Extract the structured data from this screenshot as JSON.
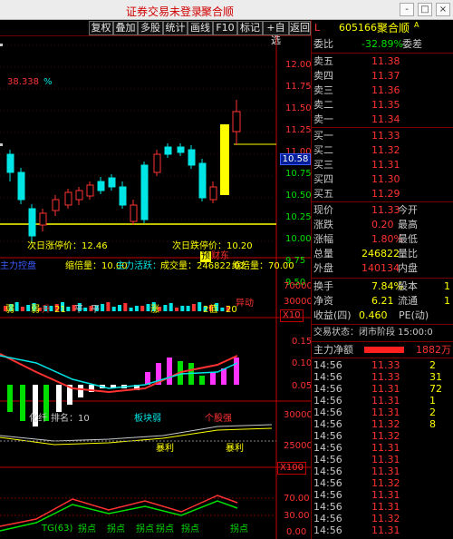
{
  "title_bar": {
    "left_text": "证券交易未登录",
    "right_text": "聚合顺",
    "buttons": [
      "-",
      "□",
      "×"
    ]
  },
  "toolbar": {
    "buttons": [
      "复权",
      "叠加",
      "多股",
      "统计",
      "画线",
      "F10",
      "标记",
      "+自选",
      "返回"
    ],
    "options_glyph": "⚙"
  },
  "main_chart": {
    "price_axis": [
      "12.00",
      "11.75",
      "11.50",
      "11.25",
      "11.00",
      "10.75",
      "10.50",
      "10.25",
      "10.00",
      "9.75",
      "9.50"
    ],
    "current_price_tag": "10.58",
    "indicator_value": "38.338",
    "indicator_unit": "%",
    "next_fall_label": "次日涨停价：12.46",
    "next_limit_label": "次日跌停价：10.20",
    "signal_red": "预",
    "signal_green": "财东",
    "volume_axis": [
      "70000",
      "30000"
    ],
    "volume_bar_labels": {
      "a": "弱",
      "b": "弱",
      "c": "升",
      "d": "21",
      "e": "平",
      "f": "平",
      "g": "涨",
      "h": "2值",
      "i": "20",
      "j": "异动"
    },
    "volume_info": {
      "label1": "主力控盘",
      "label2": "缩倍量：10.00",
      "label3": "主力活跃：",
      "label4": "成交量：246822.02",
      "label5": "缩倍量：70.00"
    },
    "multiplier": "X10",
    "macd_axis": [
      "0.15",
      "0.10",
      "0.05"
    ],
    "sector_info": {
      "name": "化纤",
      "rank_label": "排名：10",
      "strength": "板块弱",
      "sentiment": "个股强"
    },
    "sector_axis": [
      "30000",
      "25000"
    ],
    "bottom_labels": {
      "a": "暴利",
      "b": "暴利"
    },
    "multiplier2": "X100",
    "osc_axis": [
      "70.00",
      "30.00",
      "0.00"
    ],
    "osc_bottom_labels": [
      "TG(63)",
      "拐点",
      "拐点",
      "拐点",
      "拐点",
      "拐点",
      "拐点"
    ]
  },
  "quote_panel": {
    "marker": "L",
    "code": "605166",
    "name": "聚合顺",
    "name_suffix": "A",
    "weibi_label": "委比",
    "weibi": "-32.89%",
    "weicha_label": "委差",
    "weicha": "",
    "asks": [
      {
        "label": "卖五",
        "price": "11.38"
      },
      {
        "label": "卖四",
        "price": "11.37"
      },
      {
        "label": "卖三",
        "price": "11.36"
      },
      {
        "label": "卖二",
        "price": "11.35"
      },
      {
        "label": "卖一",
        "price": "11.34"
      }
    ],
    "bids": [
      {
        "label": "买一",
        "price": "11.33"
      },
      {
        "label": "买二",
        "price": "11.32"
      },
      {
        "label": "买三",
        "price": "11.31"
      },
      {
        "label": "买四",
        "price": "11.30"
      },
      {
        "label": "买五",
        "price": "11.29"
      }
    ],
    "stats": [
      {
        "l1": "现价",
        "v1": "11.33",
        "l2": "今开",
        "v2": ""
      },
      {
        "l1": "涨跌",
        "v1": "0.20",
        "l2": "最高",
        "v2": ""
      },
      {
        "l1": "涨幅",
        "v1": "1.80%",
        "l2": "最低",
        "v2": ""
      },
      {
        "l1": "总量",
        "v1": "246822",
        "l2": "量比",
        "v2": ""
      },
      {
        "l1": "外盘",
        "v1": "140134",
        "l2": "内盘",
        "v2": ""
      }
    ],
    "stats2": [
      {
        "l1": "换手",
        "v1": "7.84%",
        "l2": "股本",
        "v2": "1"
      },
      {
        "l1": "净资",
        "v1": "6.21",
        "l2": "流通",
        "v2": "1"
      },
      {
        "l1": "收益(四)",
        "v1": "0.460",
        "l2": "PE(动)",
        "v2": ""
      }
    ],
    "trade_status": "交易状态：闭市阶段 15:00:0",
    "main_fund_label": "主力净额",
    "main_fund_value": "1882万",
    "ticks": [
      {
        "time": "14:56",
        "price": "11.33",
        "vol": "2"
      },
      {
        "time": "14:56",
        "price": "11.33",
        "vol": "31"
      },
      {
        "time": "14:56",
        "price": "11.31",
        "vol": "72"
      },
      {
        "time": "14:56",
        "price": "11.31",
        "vol": "1"
      },
      {
        "time": "14:56",
        "price": "11.31",
        "vol": "2"
      },
      {
        "time": "14:56",
        "price": "11.32",
        "vol": "8"
      },
      {
        "time": "14:56",
        "price": "11.32",
        "vol": ""
      },
      {
        "time": "14:56",
        "price": "11.31",
        "vol": ""
      },
      {
        "time": "14:56",
        "price": "11.31",
        "vol": ""
      },
      {
        "time": "14:56",
        "price": "11.31",
        "vol": ""
      },
      {
        "time": "14:56",
        "price": "11.32",
        "vol": ""
      },
      {
        "time": "14:56",
        "price": "11.31",
        "vol": ""
      },
      {
        "time": "14:56",
        "price": "11.31",
        "vol": ""
      },
      {
        "time": "14:56",
        "price": "11.32",
        "vol": ""
      },
      {
        "time": "14:56",
        "price": "11.31",
        "vol": ""
      }
    ]
  },
  "colors": {
    "up": "#ff3232",
    "down": "#00e5e5",
    "yellow": "#ffff00",
    "green": "#00e000",
    "magenta": "#ff33ff",
    "axis": "#c00000"
  }
}
